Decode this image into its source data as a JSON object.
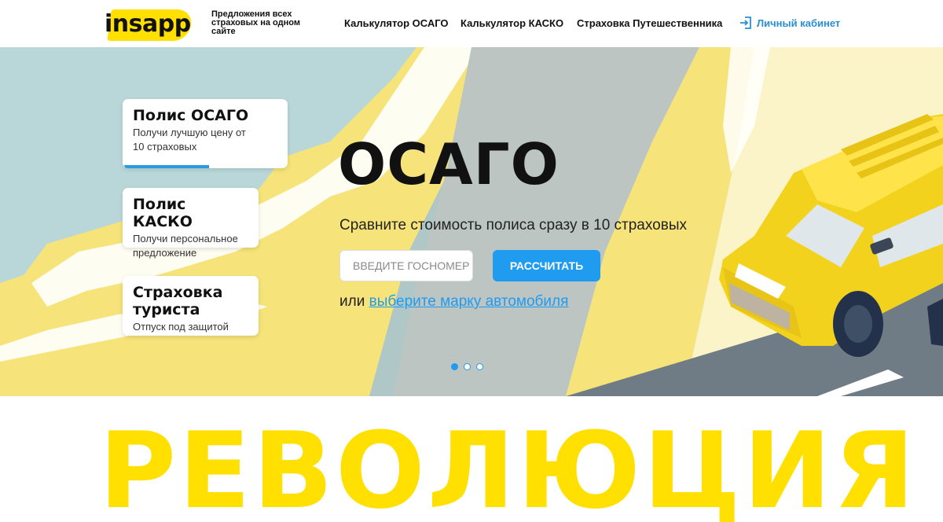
{
  "header": {
    "logo_text": "insapp",
    "tagline": "Предложения всех страховых на одном сайте",
    "nav": [
      {
        "label": "Калькулятор ОСАГО"
      },
      {
        "label": "Калькулятор КАСКО"
      },
      {
        "label": "Страховка Путешественника"
      }
    ],
    "account_label": "Личный кабинет",
    "account_icon": "login-icon"
  },
  "cards": [
    {
      "title": "Полис ОСАГО",
      "subtitle": "Получи лучшую цену от 10 страховых",
      "active": true
    },
    {
      "title": "Полис КАСКО",
      "subtitle": "Получи персональное предложение",
      "active": false
    },
    {
      "title": "Страховка туриста",
      "subtitle": "Отпуск под защитой",
      "active": false
    }
  ],
  "hero": {
    "title": "ОСАГО",
    "subtitle": "Сравните стоимость полиса сразу в 10 страховых",
    "plate_placeholder": "Введите госномер",
    "calc_button": "РАССЧИТАТЬ",
    "or_text": "или ",
    "brand_link": "выберите марку автомобиля",
    "slides": 3,
    "active_slide": 1
  },
  "banner": {
    "text": "РЕВОЛЮЦИЯ"
  },
  "colors": {
    "accent_blue": "#1f9bf0",
    "brand_yellow": "#ffe000",
    "hero_teal": "#b9d7d9",
    "hero_gray": "#bcc5c2"
  }
}
